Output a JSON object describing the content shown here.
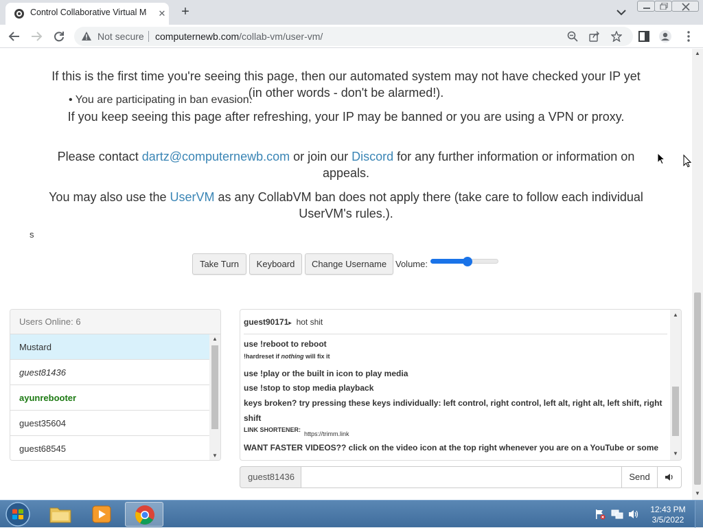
{
  "browser": {
    "tab_title": "Control Collaborative Virtual Ma",
    "security_label": "Not secure",
    "url_host": "computernewb.com",
    "url_path": "/collab-vm/user-vm/"
  },
  "page": {
    "bullet": "You are participating in ban evasion.",
    "para1": "If this is the first time you're seeing this page, then our automated system may not have checked your IP yet (in other words - don't be alarmed!).",
    "para2": "If you keep seeing this page after refreshing, your IP may be banned or you are using a VPN or proxy.",
    "para3_prefix": "Please contact ",
    "para3_email": "dartz@computernewb.com",
    "para3_mid": " or join our ",
    "para3_discord": "Discord",
    "para3_suffix": " for any further information or information on appeals.",
    "para4_prefix": "You may also use the ",
    "para4_link": "UserVM",
    "para4_suffix": " as any CollabVM ban does not apply there (take care to follow each individual UserVM's rules.).",
    "stray_text": "s"
  },
  "controls": {
    "take_turn": "Take Turn",
    "keyboard": "Keyboard",
    "change_username": "Change Username",
    "volume_label": "Volume:",
    "volume_fraction": 0.55
  },
  "users_panel": {
    "header": "Users Online: 6",
    "users": [
      {
        "name": "Mustard",
        "style": "highlight"
      },
      {
        "name": "guest81436",
        "style": "italic"
      },
      {
        "name": "ayunrebooter",
        "style": "admin"
      },
      {
        "name": "guest35604",
        "style": "normal"
      },
      {
        "name": "guest68545",
        "style": "normal"
      }
    ]
  },
  "chat": {
    "first_user": "guest90171",
    "first_arrow": "▸",
    "first_msg": "hot shit",
    "line_reboot": "use !reboot to reboot",
    "hardreset_a": "!hardreset if ",
    "hardreset_em": "nothing",
    "hardreset_b": " will fix it",
    "line_play": "use !play or the built in icon to play media",
    "line_stop": "use !stop to stop media playback",
    "line_keys_1": "keys broken? try pressing these keys individually: left control, right control, left alt, right alt, left shift, right",
    "line_keys_2": "shift",
    "shortener_label": "LINK SHORTENER:",
    "shortener_url": "https://trimm.link",
    "line_faster": "WANT FASTER VIDEOS?? click on the video icon at the top right whenever you are on a YouTube or some"
  },
  "chat_input": {
    "username": "guest81436",
    "value": "",
    "send_label": "Send"
  },
  "taskbar": {
    "time": "12:43 PM",
    "date": "3/5/2022"
  },
  "colors": {
    "link": "#3a85b5",
    "highlight_row": "#d9f1fb",
    "admin_user": "#1d7a13",
    "slider": "#1a73e8",
    "taskbar": "#3f6d9c"
  }
}
